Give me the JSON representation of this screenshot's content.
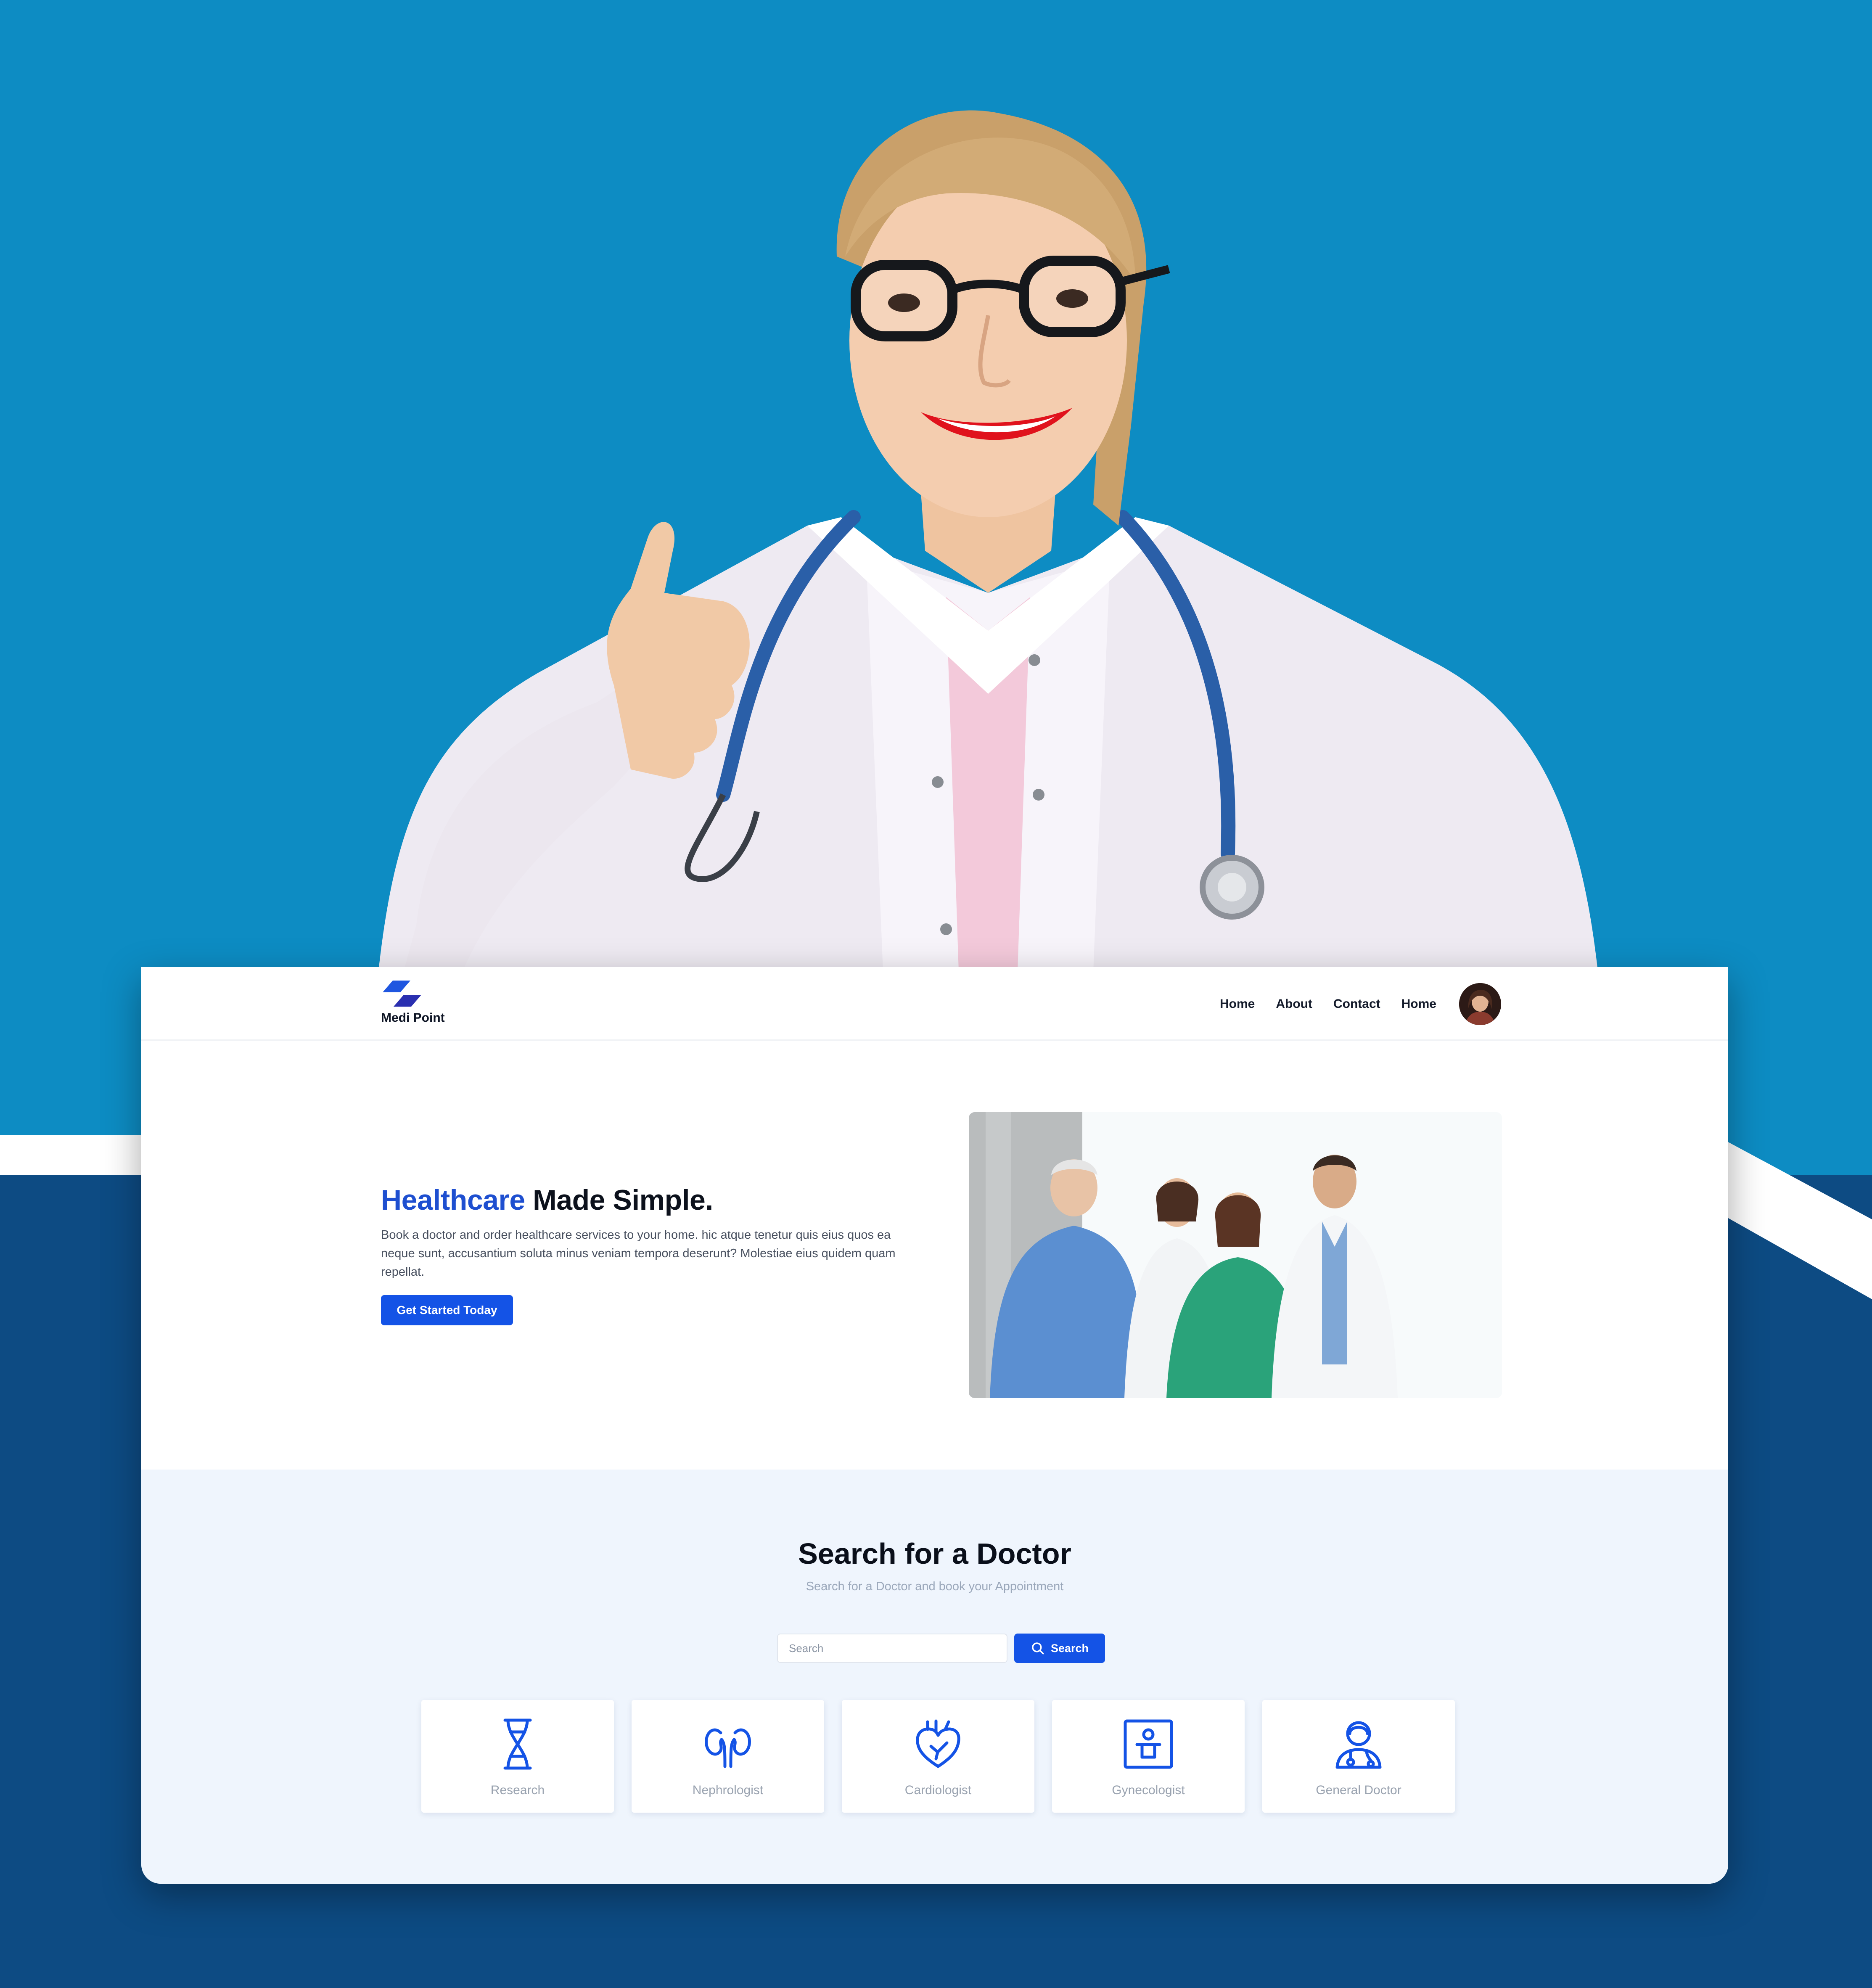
{
  "poster": {
    "colors": {
      "sky": "#0d8cc3",
      "navy": "#0d4b83",
      "accent": "#1453e6",
      "brand_blue": "#1e4fd0"
    }
  },
  "nav": {
    "logo_text": "Medi Point",
    "links": [
      "Home",
      "About",
      "Contact",
      "Home"
    ],
    "avatar_icon": "user-avatar"
  },
  "hero": {
    "title_accent": "Healthcare",
    "title_rest": " Made Simple.",
    "description": "Book a doctor and order healthcare services to your home. hic atque tenetur quis eius quos ea neque sunt, accusantium soluta minus veniam tempora deserunt? Molestiae eius quidem quam repellat.",
    "cta_label": "Get Started Today"
  },
  "search": {
    "title": "Search for a Doctor",
    "subtitle": "Search for a Doctor and book your Appointment",
    "placeholder": "Search",
    "button_label": "Search"
  },
  "categories": [
    {
      "label": "Research",
      "icon": "dna-icon"
    },
    {
      "label": "Nephrologist",
      "icon": "kidneys-icon"
    },
    {
      "label": "Cardiologist",
      "icon": "heart-icon"
    },
    {
      "label": "Gynecologist",
      "icon": "baby-monitor-icon"
    },
    {
      "label": "General Doctor",
      "icon": "doctor-icon"
    }
  ]
}
